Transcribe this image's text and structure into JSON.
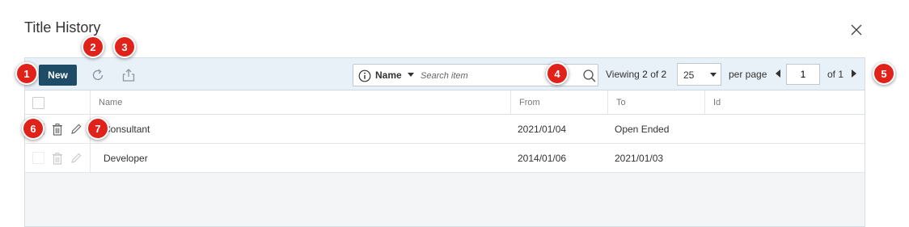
{
  "dialog": {
    "title": "Title History"
  },
  "toolbar": {
    "new_label": "New",
    "search": {
      "field": "Name",
      "placeholder": "Search item"
    },
    "viewing_prefix": "Viewing",
    "viewing_current": "2",
    "viewing_of": "of",
    "viewing_total": "2",
    "per_page_value": "25",
    "per_page_label": "per page",
    "page_value": "1",
    "of_pages": "of 1"
  },
  "grid": {
    "columns": [
      "Name",
      "From",
      "To",
      "Id"
    ],
    "rows": [
      {
        "name": "Consultant",
        "from": "2021/01/04",
        "to": "Open Ended",
        "id": ""
      },
      {
        "name": "Developer",
        "from": "2014/01/06",
        "to": "2021/01/03",
        "id": ""
      }
    ]
  },
  "callouts": [
    "1",
    "2",
    "3",
    "4",
    "5",
    "6",
    "7"
  ],
  "colors": {
    "accent": "#1e4c66",
    "toolbar_bg": "#e9f1f8",
    "callout": "#e0221b"
  },
  "icons": {
    "close": "close-icon",
    "refresh": "refresh-icon",
    "export": "export-icon",
    "info": "info-icon",
    "search": "search-icon",
    "delete": "trash-icon",
    "edit": "pencil-icon"
  }
}
